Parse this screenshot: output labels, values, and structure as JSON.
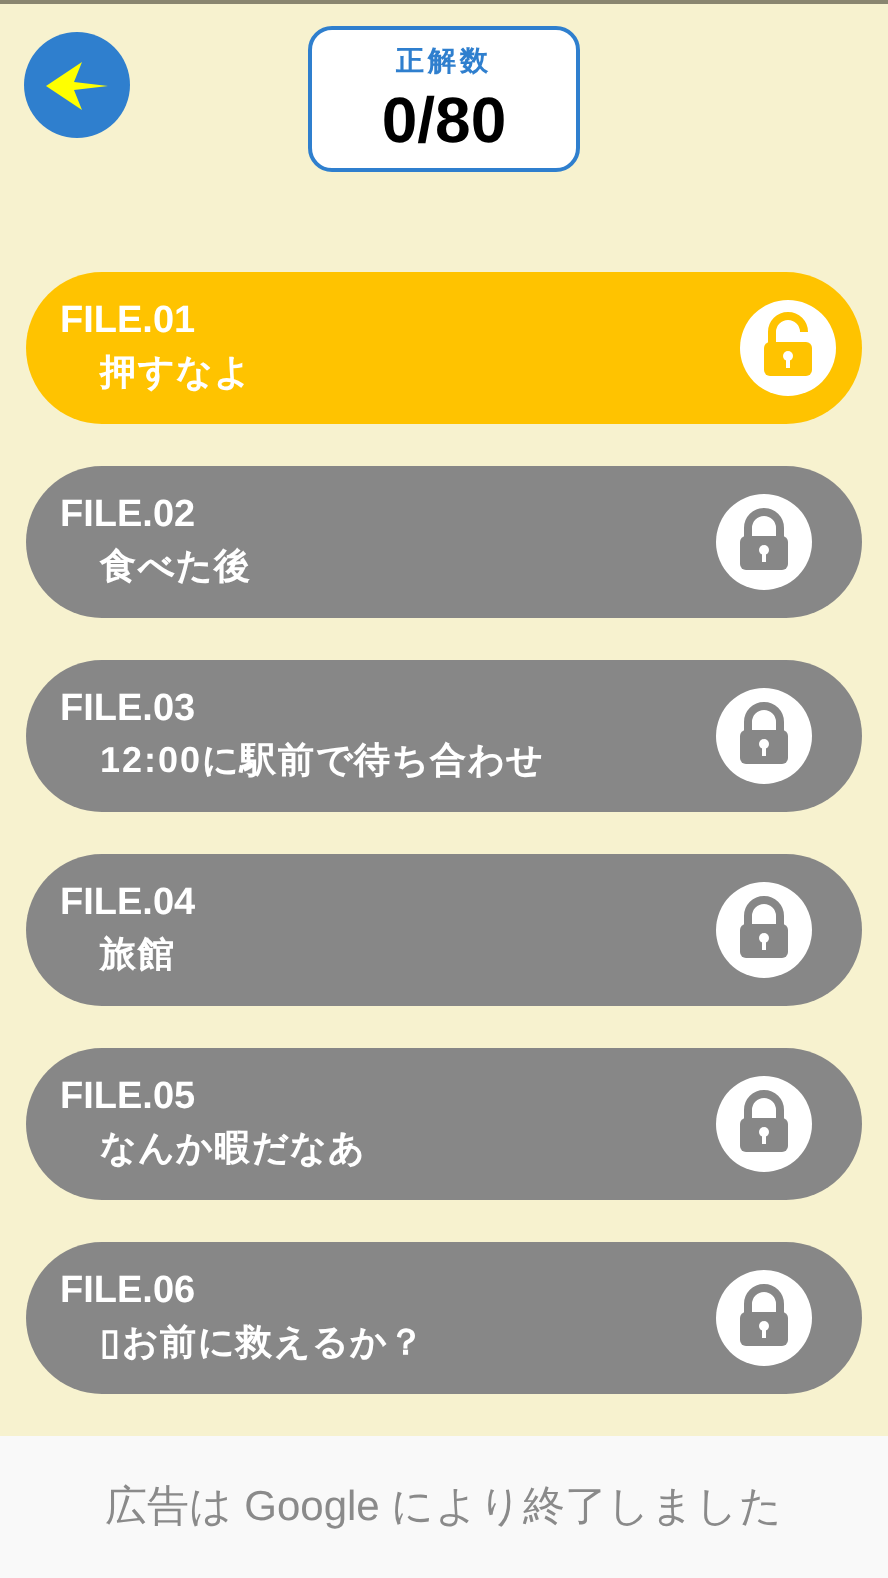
{
  "score": {
    "label": "正解数",
    "value": "0/80"
  },
  "files": [
    {
      "number": "FILE.01",
      "title": "押すなよ",
      "unlocked": true
    },
    {
      "number": "FILE.02",
      "title": "食べた後",
      "unlocked": false
    },
    {
      "number": "FILE.03",
      "title": "12:00に駅前で待ち合わせ",
      "unlocked": false
    },
    {
      "number": "FILE.04",
      "title": "旅館",
      "unlocked": false
    },
    {
      "number": "FILE.05",
      "title": "なんか暇だなあ",
      "unlocked": false
    },
    {
      "number": "FILE.06",
      "title": "▯お前に救えるか？",
      "unlocked": false
    }
  ],
  "ad_banner": {
    "text": "広告は Google により終了しました"
  }
}
